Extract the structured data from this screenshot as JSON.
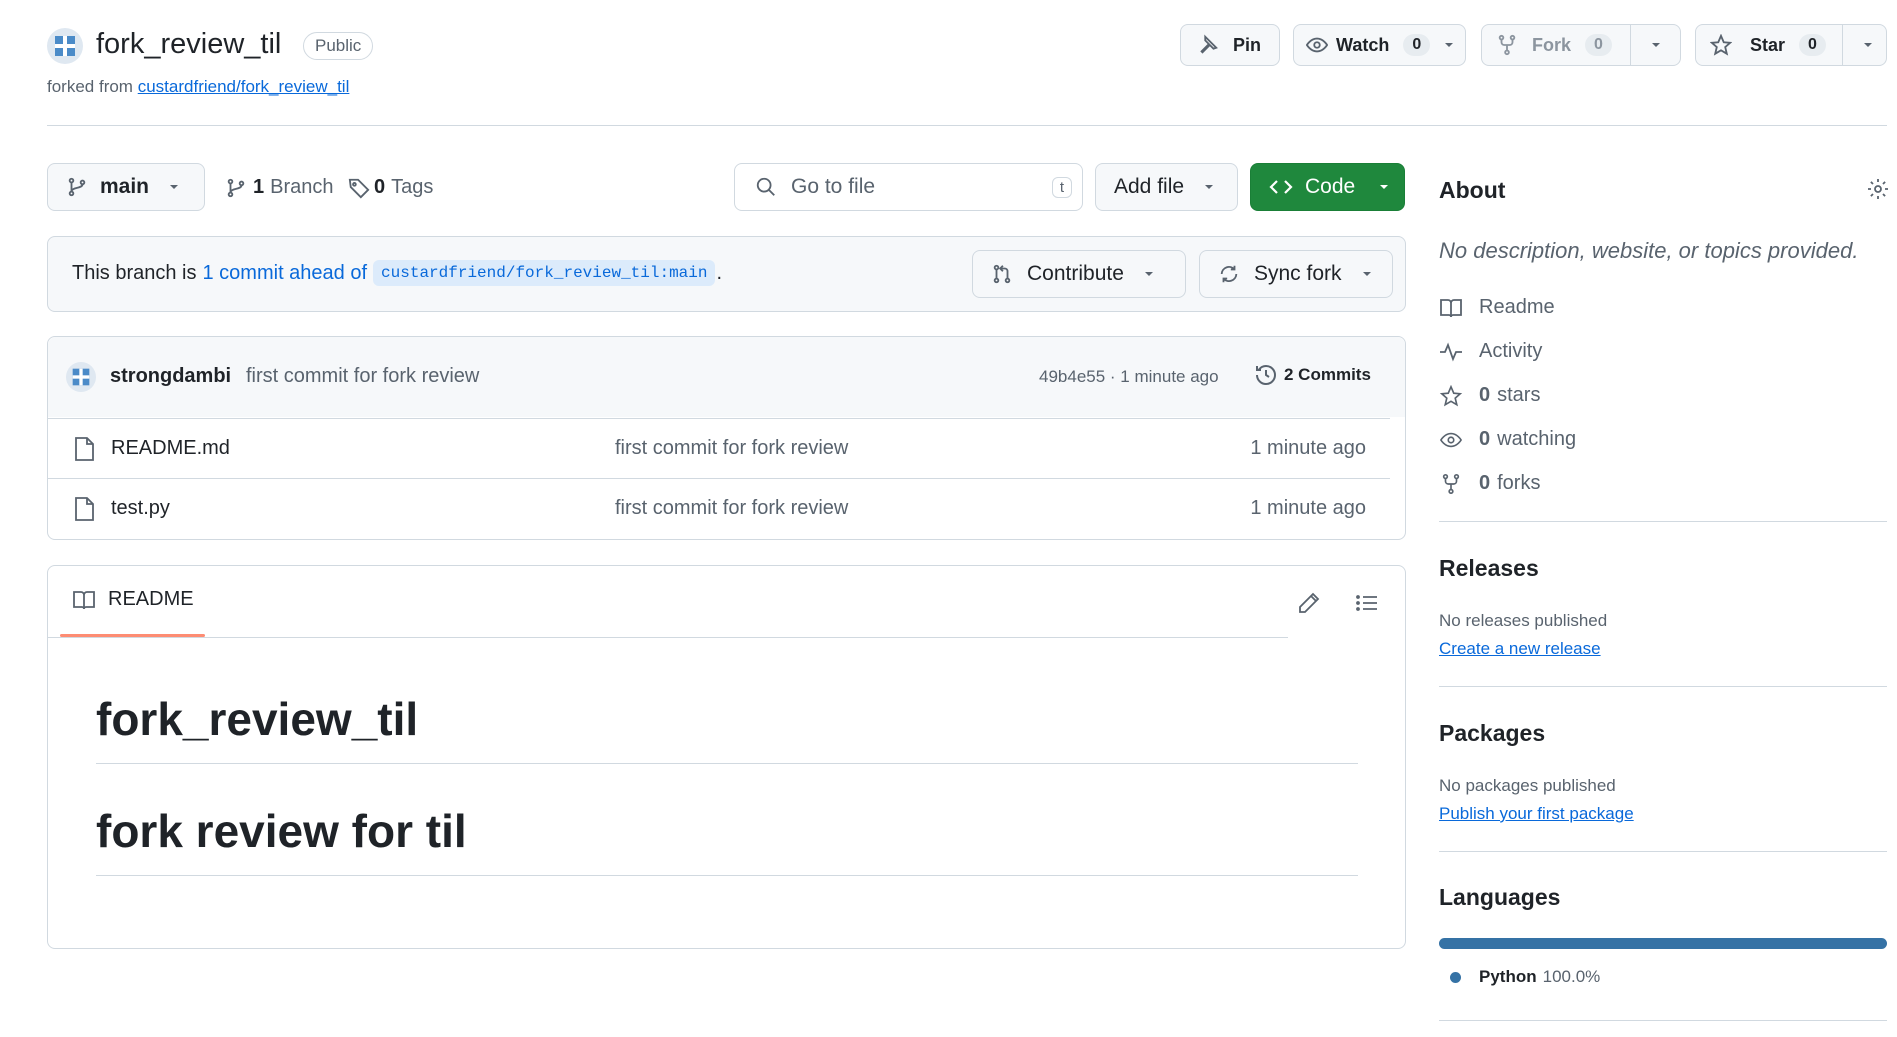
{
  "repo": {
    "name": "fork_review_til",
    "visibility": "Public",
    "forked_from_prefix": "forked from",
    "forked_from_link": "custardfriend/fork_review_til"
  },
  "header_actions": {
    "pin_label": "Pin",
    "watch_label": "Watch",
    "watch_count": "0",
    "fork_label": "Fork",
    "fork_count": "0",
    "star_label": "Star",
    "star_count": "0"
  },
  "toolbar": {
    "branch": "main",
    "branches_count": "1",
    "branches_label": "Branch",
    "tags_count": "0",
    "tags_label": "Tags",
    "search_placeholder": "Go to file",
    "search_shortcut": "t",
    "add_file_label": "Add file",
    "code_label": "Code"
  },
  "branch_status": {
    "prefix": "This branch is",
    "ahead_link": "1 commit ahead of",
    "ref": "custardfriend/fork_review_til:main",
    "suffix": ".",
    "contribute_label": "Contribute",
    "sync_label": "Sync fork"
  },
  "latest_commit": {
    "author": "strongdambi",
    "message": "first commit for fork review",
    "meta": "49b4e55 · 1 minute ago",
    "commits_label": "2 Commits"
  },
  "files": [
    {
      "name": "README.md",
      "message": "first commit for fork review",
      "time": "1 minute ago"
    },
    {
      "name": "test.py",
      "message": "first commit for fork review",
      "time": "1 minute ago"
    }
  ],
  "readme": {
    "tab_label": "README",
    "heading1": "fork_review_til",
    "heading2": "fork review for til"
  },
  "about": {
    "title": "About",
    "description": "No description, website, or topics provided.",
    "readme_label": "Readme",
    "activity_label": "Activity",
    "stars_count": "0",
    "stars_label": "stars",
    "watching_count": "0",
    "watching_label": "watching",
    "forks_count": "0",
    "forks_label": "forks"
  },
  "releases": {
    "title": "Releases",
    "empty_text": "No releases published",
    "create_link": "Create a new release"
  },
  "packages": {
    "title": "Packages",
    "empty_text": "No packages published",
    "publish_link": "Publish your first package"
  },
  "languages": {
    "title": "Languages",
    "items": [
      {
        "name": "Python",
        "percent": "100.0%",
        "fraction": 1.0,
        "color": "#3572A5"
      }
    ]
  },
  "colors": {
    "accent_link": "#0969da",
    "code_button": "#1f883d",
    "readme_tab_underline": "#fd8c73",
    "python": "#3572A5"
  }
}
